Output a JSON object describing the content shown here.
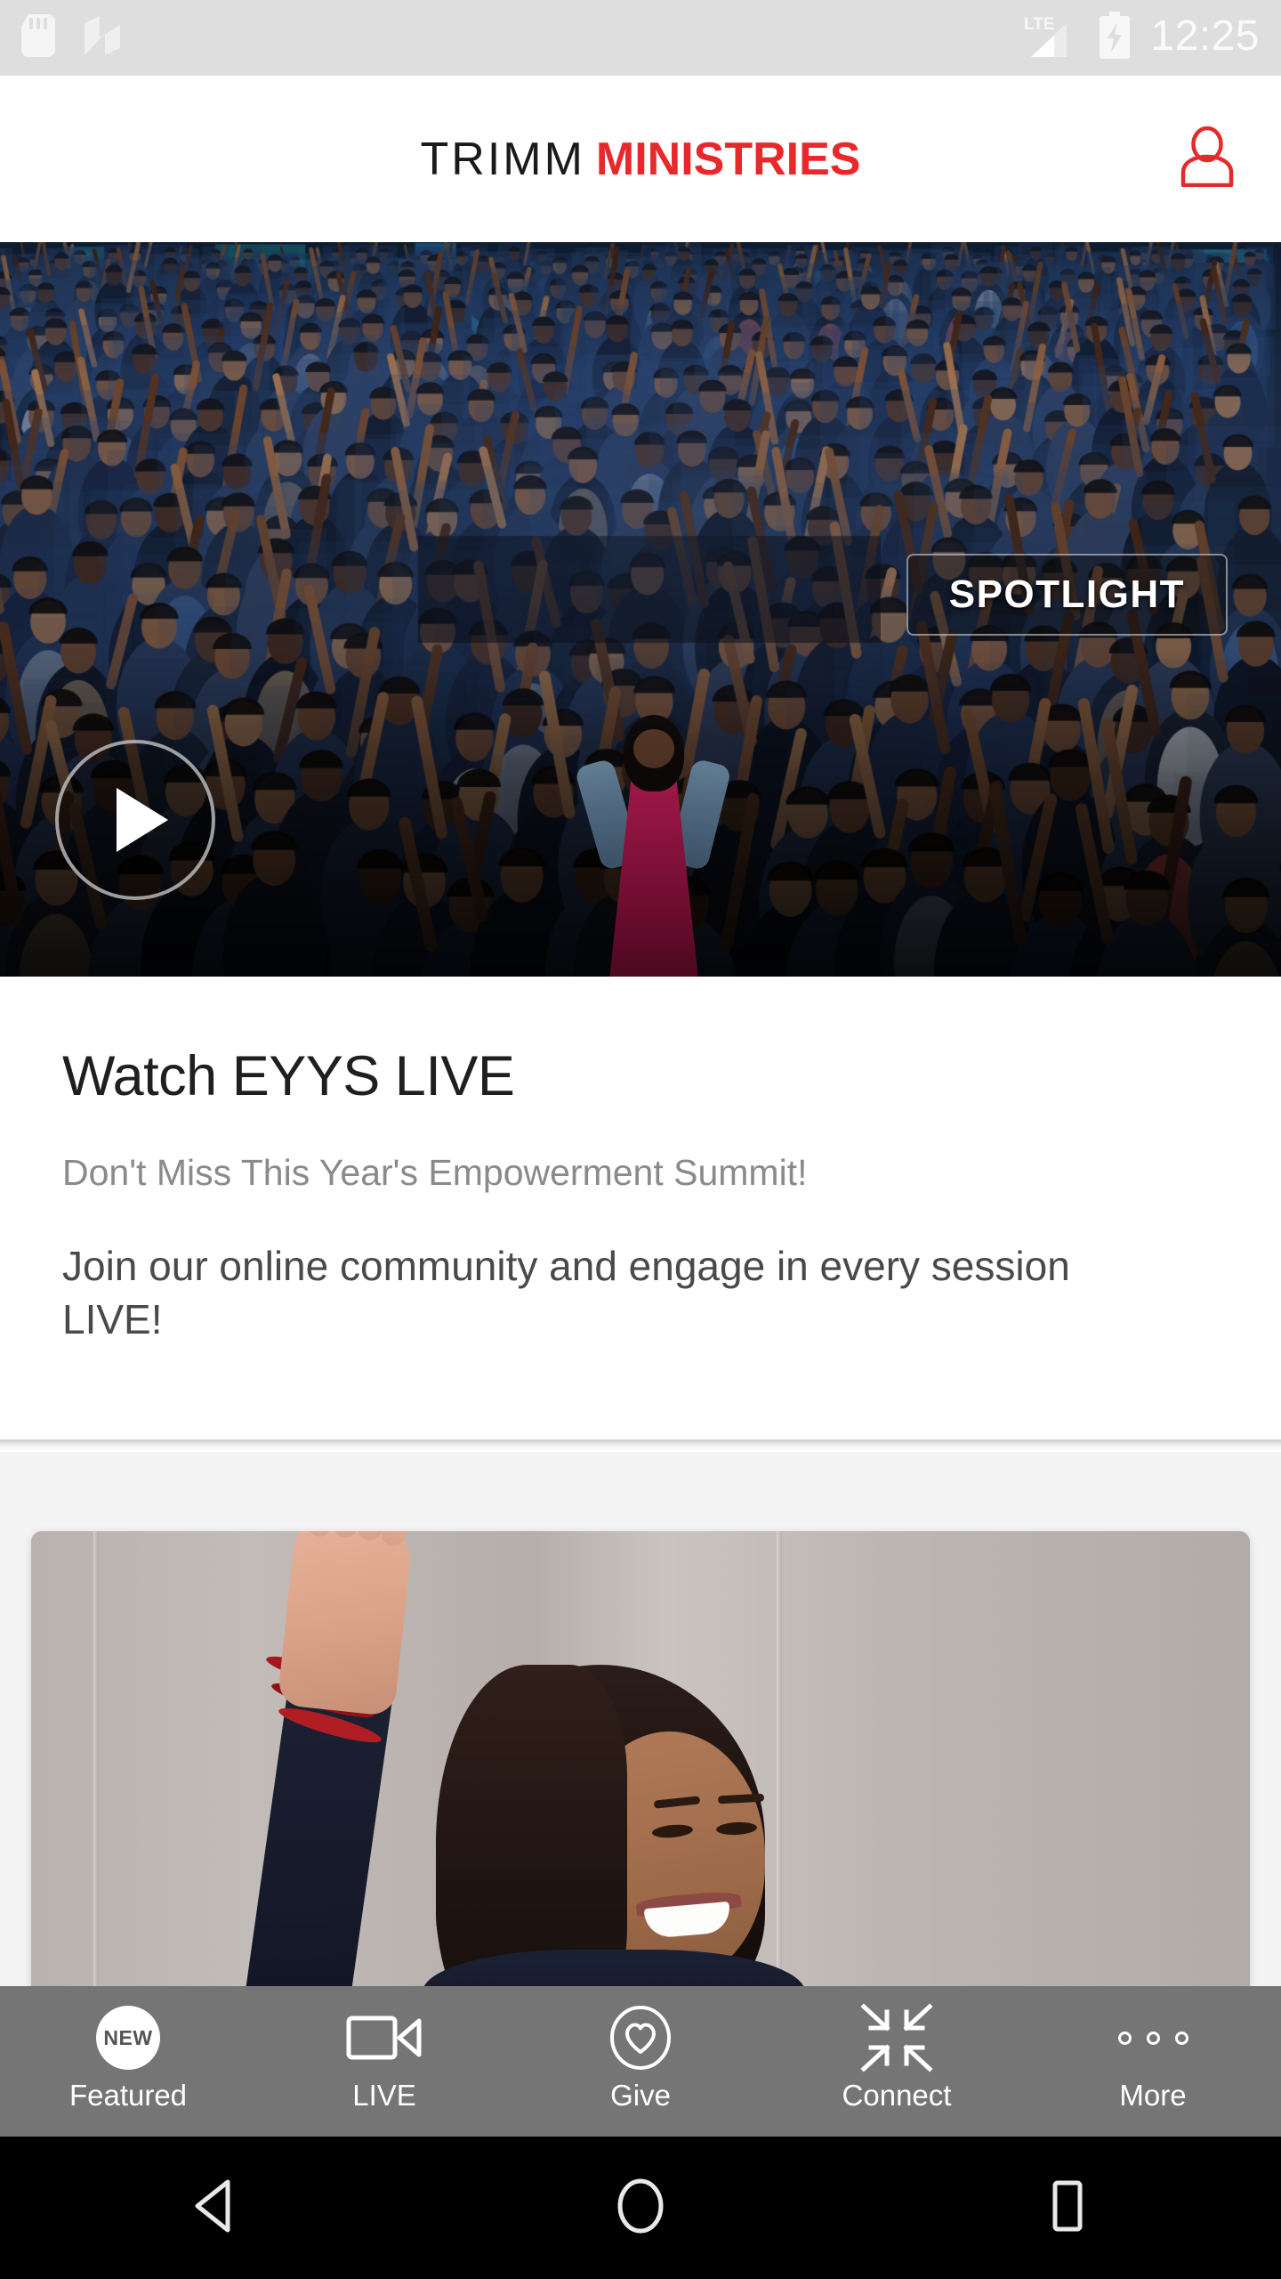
{
  "status_bar": {
    "icons_left": [
      "sd-card-icon",
      "android-nougat-icon"
    ],
    "network_label": "LTE",
    "icons_right": [
      "signal-icon",
      "battery-charging-icon"
    ],
    "time": "12:25",
    "background_color": "#dedede",
    "foreground_color": "#fafafa"
  },
  "header": {
    "logo_part1": "TRIMM",
    "logo_part2": "MINISTRIES",
    "brand_red": "#e8282b",
    "brand_dark": "#1a1a1a",
    "account_icon": "person-icon"
  },
  "hero": {
    "badge_label": "SPOTLIGHT",
    "play_icon": "play-icon",
    "alt": "Large worship crowd with hands raised; woman in pink dress on stage"
  },
  "article": {
    "title": "Watch EYYS LIVE",
    "subtitle": "Don't Miss This Year's Empowerment Summit!",
    "body": "Join our online community and engage in every session LIVE!"
  },
  "next_card": {
    "alt": "Woman with long dark hair raising her hand, smiling"
  },
  "tab_bar": {
    "background_color": "#757575",
    "active_index": 0,
    "items": [
      {
        "label": "Featured",
        "icon": "new-badge-icon",
        "badge_text": "NEW"
      },
      {
        "label": "LIVE",
        "icon": "video-camera-icon"
      },
      {
        "label": "Give",
        "icon": "heart-circle-icon"
      },
      {
        "label": "Connect",
        "icon": "arrows-inward-icon"
      },
      {
        "label": "More",
        "icon": "more-dots-icon"
      }
    ]
  },
  "android_nav": {
    "items": [
      {
        "name": "back-button",
        "icon": "triangle-left-icon"
      },
      {
        "name": "home-button",
        "icon": "circle-icon"
      },
      {
        "name": "recents-button",
        "icon": "square-icon"
      }
    ]
  }
}
